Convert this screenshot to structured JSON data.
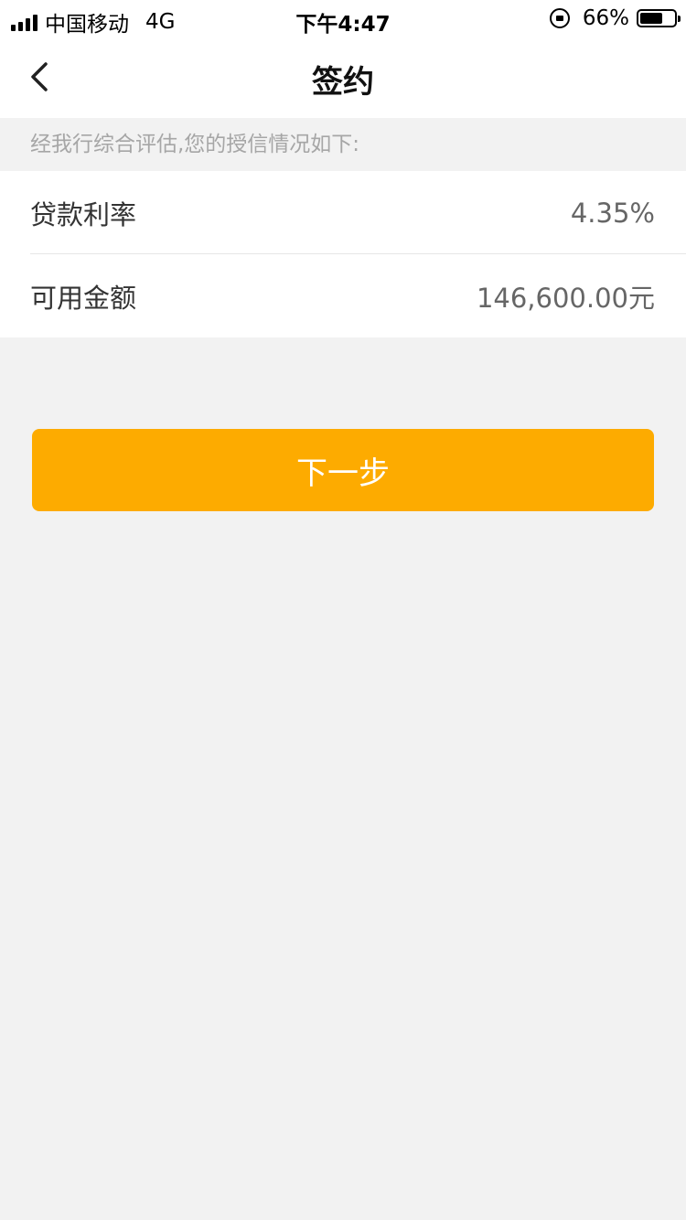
{
  "status_bar": {
    "carrier": "中国移动",
    "network": "4G",
    "time": "下午4:47",
    "battery_percent": "66%",
    "battery_level": 0.66
  },
  "nav": {
    "title": "签约",
    "back_icon": "chevron-left-icon"
  },
  "notice": "经我行综合评估,您的授信情况如下:",
  "info_rows": [
    {
      "label": "贷款利率",
      "value": "4.35%"
    },
    {
      "label": "可用金额",
      "value": "146,600.00元"
    }
  ],
  "next_button_label": "下一步",
  "colors": {
    "accent": "#fdab00",
    "background": "#f2f2f2",
    "card": "#ffffff",
    "notice_text": "#a6a6a6"
  }
}
